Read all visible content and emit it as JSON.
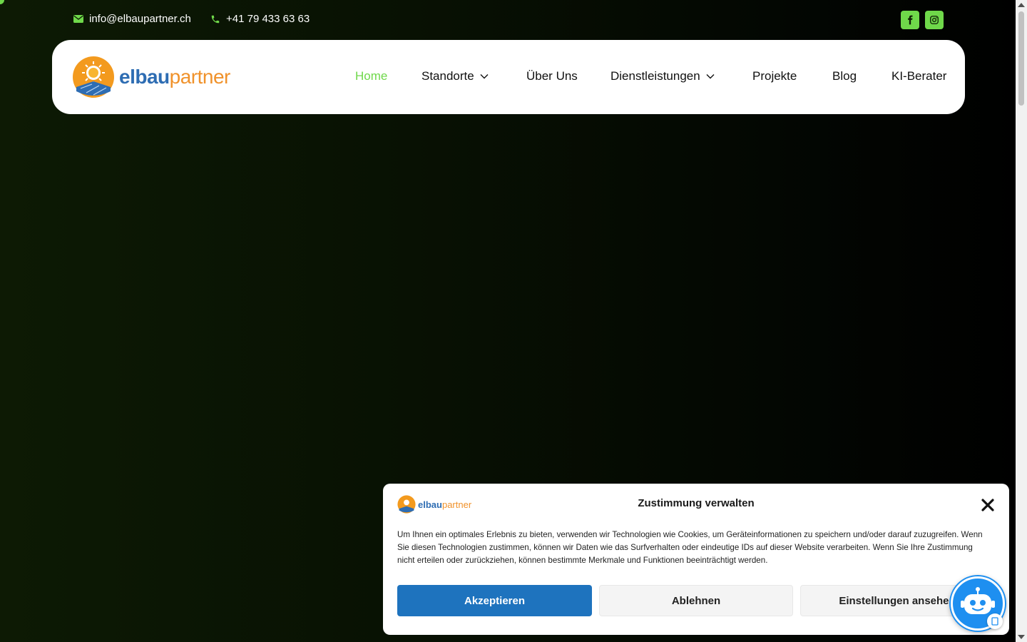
{
  "topbar": {
    "email": "info@elbaupartner.ch",
    "phone": "+41 79 433 63 63",
    "social": [
      {
        "icon": "facebook-icon"
      },
      {
        "icon": "instagram-icon"
      }
    ]
  },
  "header": {
    "logo": {
      "part1": "elbau",
      "part2": "partner"
    },
    "nav": [
      {
        "label": "Home",
        "active": true
      },
      {
        "label": "Standorte",
        "dropdown": true
      },
      {
        "label": "Über Uns"
      },
      {
        "label": "Dienstleistungen",
        "dropdown": true
      },
      {
        "label": "Projekte"
      },
      {
        "label": "Blog"
      },
      {
        "label": "KI-Berater"
      }
    ]
  },
  "cookie": {
    "logo": {
      "part1": "elbau",
      "part2": "partner"
    },
    "title": "Zustimmung verwalten",
    "text": "Um Ihnen ein optimales Erlebnis zu bieten, verwenden wir Technologien wie Cookies, um Geräteinformationen zu speichern und/oder darauf zuzugreifen. Wenn Sie diesen Technologien zustimmen, können wir Daten wie das Surfverhalten oder eindeutige IDs auf dieser Website verarbeiten. Wenn Sie Ihre Zustimmung nicht erteilen oder zurückziehen, können bestimmte Merkmale und Funktionen beeinträchtigt werden.",
    "accept_label": "Akzeptieren",
    "deny_label": "Ablehnen",
    "settings_label": "Einstellungen ansehen"
  },
  "colors": {
    "accent_green": "#6fd84a",
    "brand_blue": "#2e6db3",
    "brand_orange": "#f0922b",
    "button_blue": "#1e73be"
  }
}
